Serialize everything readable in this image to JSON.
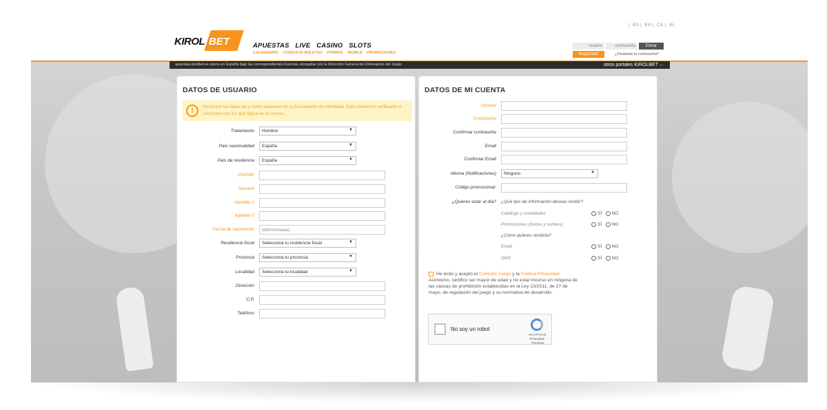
{
  "header": {
    "languages": [
      "ES",
      "EN",
      "CA",
      "GL"
    ],
    "logo": {
      "text_dark": "KIROL",
      "text_light": "BET"
    },
    "nav": [
      "APUESTAS",
      "LIVE",
      "CASINO",
      "SLOTS"
    ],
    "subnav": [
      "CALENDARIO",
      "CONSULTA BOLETOS",
      "PORRAS",
      "MOBILE",
      "PROMOCIONES"
    ],
    "login": {
      "user_placeholder": "usuario",
      "pass_placeholder": "contraseña",
      "enter_label": "Entrar",
      "register_label": "Registrate!",
      "forgot_label": "¿Olvidaste tu contraseña?"
    },
    "strip_text": "apuestas.kirolbet.es opera en España bajo las correspondientes licencias otorgadas por la Dirección General de Ordenación del Juego",
    "other_portals": "otros portales KIROLBET"
  },
  "left_panel": {
    "title": "DATOS DE USUARIO",
    "warning": "Introduce tus datos tal y como aparecen en tu Documento de Identidad. Solo podremos verificarte si coinciden con los que figura en el mismo.",
    "fields": {
      "tratamiento": {
        "label": "Tratamiento",
        "value": "Hombre"
      },
      "nacionalidad": {
        "label": "País nacionalidad",
        "value": "España"
      },
      "residencia": {
        "label": "País de residencia",
        "value": "España"
      },
      "dni": {
        "label": "DNI/NIE"
      },
      "nombre": {
        "label": "Nombre"
      },
      "apellido1": {
        "label": "Apellido 1"
      },
      "apellido2": {
        "label": "Apellido 2"
      },
      "nacimiento": {
        "label": "Fecha de nacimiento",
        "placeholder": "(dd/mm/aaaa)"
      },
      "fiscal": {
        "label": "Residencia fiscal",
        "value": "Selecciona tu residencia fiscal"
      },
      "provincia": {
        "label": "Provincia",
        "value": "Selecciona tu provincia"
      },
      "localidad": {
        "label": "Localidad",
        "value": "Selecciona tu localidad"
      },
      "direccion": {
        "label": "Dirección"
      },
      "cp": {
        "label": "C.P."
      },
      "telefono": {
        "label": "Teléfono"
      }
    }
  },
  "right_panel": {
    "title": "DATOS DE MI CUENTA",
    "fields": {
      "usuario": {
        "label": "Usuario"
      },
      "contrasena": {
        "label": "Contraseña"
      },
      "confirmar_contrasena": {
        "label": "Confirmar contraseña"
      },
      "email": {
        "label": "Email"
      },
      "confirmar_email": {
        "label": "Confirmar Email"
      },
      "idioma": {
        "label": "Idioma (Notificaciones)",
        "value": "Ninguno"
      },
      "codigo": {
        "label": "Código promocional:"
      }
    },
    "newsletter": {
      "question": "¿Quieres estar al día?",
      "info_question": "¿Qué tipo de información deseas recibir?",
      "catalogo": "Catálogo y novedades",
      "promociones": "Promociones (bonos y sorteos)",
      "how_question": "¿Cómo quieres recibirla?",
      "email": "Email",
      "sms": "SMS",
      "yes": "SÍ",
      "no": "NO"
    },
    "legal": {
      "prefix": "He leído y acepto el ",
      "contract": "Contrato Juego",
      "and": " y la ",
      "privacy": "Política Privacidad",
      "text": "Asimismo, certifico ser mayor de edad y no estar incurso en ninguna de las causas de prohibición establecidas en la Ley 13/2011, de 27 de mayo, de regulación del juego y su normativa de desarrollo."
    },
    "captcha": {
      "label": "No soy un robot",
      "brand": "reCAPTCHA",
      "links": "Privacidad - Términos"
    }
  },
  "colors": {
    "accent": "#f7931e",
    "dark_strip": "#2b2b2b"
  }
}
